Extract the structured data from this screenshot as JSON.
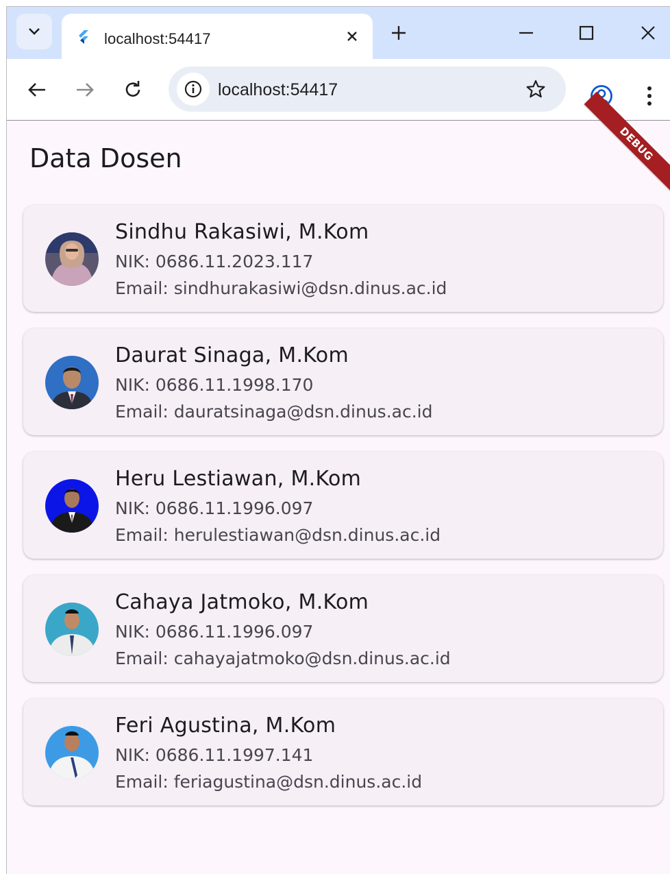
{
  "browser": {
    "tab_title": "localhost:54417",
    "url": "localhost:54417"
  },
  "app": {
    "title": "Data Dosen",
    "debug_banner": "DEBUG"
  },
  "lecturers": [
    {
      "name": "Sindhu Rakasiwi, M.Kom",
      "nik": "NIK: 0686.11.2023.117",
      "email": "Email: sindhurakasiwi@dsn.dinus.ac.id",
      "photo_bg": "#5a5670"
    },
    {
      "name": "Daurat Sinaga, M.Kom",
      "nik": "NIK: 0686.11.1998.170",
      "email": "Email: dauratsinaga@dsn.dinus.ac.id",
      "photo_bg": "#2f6fc4"
    },
    {
      "name": "Heru Lestiawan, M.Kom",
      "nik": "NIK: 0686.11.1996.097",
      "email": "Email: herulestiawan@dsn.dinus.ac.id",
      "photo_bg": "#0b16e6"
    },
    {
      "name": "Cahaya Jatmoko, M.Kom",
      "nik": "NIK: 0686.11.1996.097",
      "email": "Email: cahayajatmoko@dsn.dinus.ac.id",
      "photo_bg": "#3aa7c9"
    },
    {
      "name": "Feri Agustina, M.Kom",
      "nik": "NIK: 0686.11.1997.141",
      "email": "Email: feriagustina@dsn.dinus.ac.id",
      "photo_bg": "#3d9be6"
    }
  ],
  "colors": {
    "tabstrip": "#d3e3fd",
    "page_bg": "#fdf7fd",
    "card_bg": "#f6eff6",
    "debug": "#a51e21",
    "accent": "#0b57d0"
  }
}
